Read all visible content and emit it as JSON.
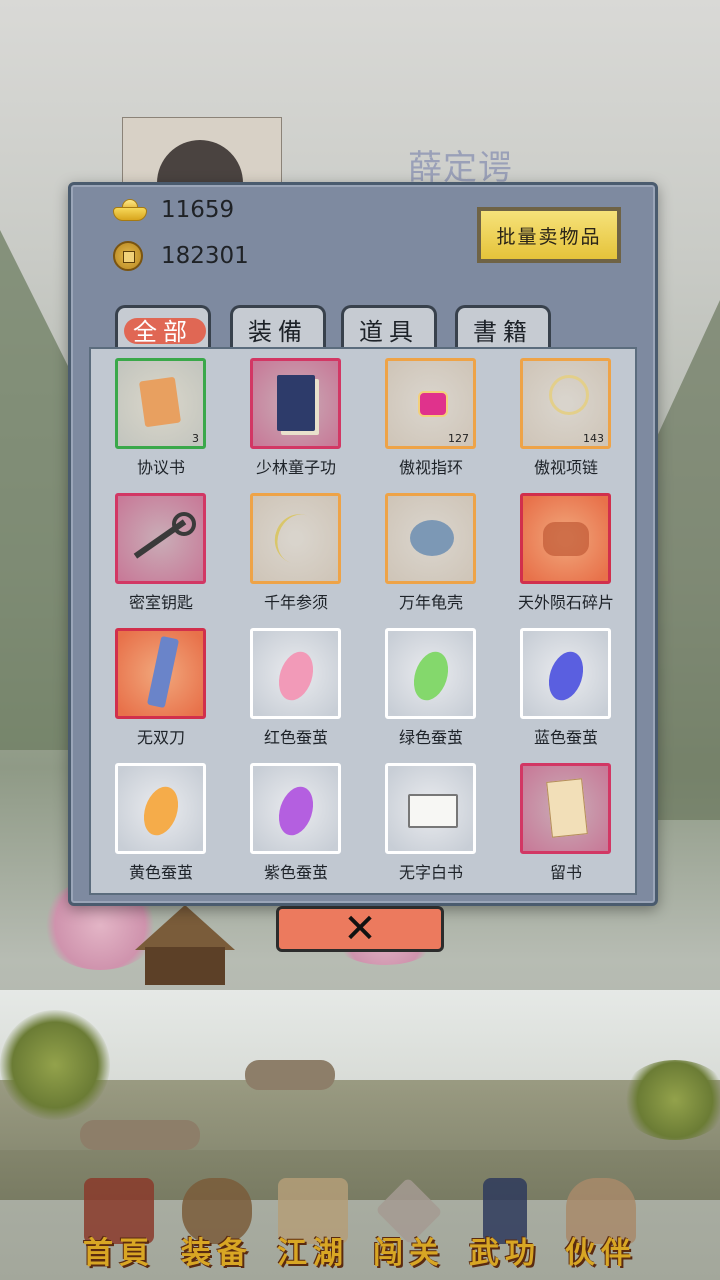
{
  "background": {
    "ghost_name": "薛定谔"
  },
  "currency": {
    "gold": "11659",
    "coins": "182301",
    "gold_icon": "gold-ingot-icon",
    "coin_icon": "copper-coin-icon"
  },
  "panel": {
    "bulk_sell_label": "批量卖物品",
    "tabs": [
      {
        "label": "全部",
        "active": true
      },
      {
        "label": "装備",
        "active": false
      },
      {
        "label": "道具",
        "active": false
      },
      {
        "label": "書籍",
        "active": false
      }
    ],
    "items": [
      {
        "name": "协议书",
        "count": "3",
        "rarity": "green",
        "icon": "document-icon"
      },
      {
        "name": "少林童子功",
        "count": "",
        "rarity": "red",
        "icon": "book-icon"
      },
      {
        "name": "傲视指环",
        "count": "127",
        "rarity": "orange",
        "icon": "ring-icon"
      },
      {
        "name": "傲视项链",
        "count": "143",
        "rarity": "orange",
        "icon": "necklace-icon"
      },
      {
        "name": "密室钥匙",
        "count": "",
        "rarity": "red",
        "icon": "key-icon"
      },
      {
        "name": "千年参须",
        "count": "",
        "rarity": "orange",
        "icon": "ginseng-icon"
      },
      {
        "name": "万年龟壳",
        "count": "",
        "rarity": "orange",
        "icon": "turtle-shell-icon"
      },
      {
        "name": "天外陨石碎片",
        "count": "",
        "rarity": "crimson",
        "icon": "meteorite-icon"
      },
      {
        "name": "无双刀",
        "count": "",
        "rarity": "crimson",
        "icon": "saber-icon"
      },
      {
        "name": "红色蚕茧",
        "count": "",
        "rarity": "white",
        "icon": "red-cocoon-icon"
      },
      {
        "name": "绿色蚕茧",
        "count": "",
        "rarity": "white",
        "icon": "green-cocoon-icon"
      },
      {
        "name": "蓝色蚕茧",
        "count": "",
        "rarity": "white",
        "icon": "blue-cocoon-icon"
      },
      {
        "name": "黄色蚕茧",
        "count": "",
        "rarity": "white",
        "icon": "yellow-cocoon-icon"
      },
      {
        "name": "紫色蚕茧",
        "count": "",
        "rarity": "white",
        "icon": "purple-cocoon-icon"
      },
      {
        "name": "无字白书",
        "count": "",
        "rarity": "white",
        "icon": "open-book-icon"
      },
      {
        "name": "留书",
        "count": "",
        "rarity": "red",
        "icon": "letter-icon"
      }
    ],
    "close_label": "✕"
  },
  "nav": [
    {
      "label": "首頁",
      "icon": "home-icon"
    },
    {
      "label": "装备",
      "icon": "armor-icon"
    },
    {
      "label": "江湖",
      "icon": "map-scroll-icon"
    },
    {
      "label": "闯关",
      "icon": "crossed-swords-icon"
    },
    {
      "label": "武功",
      "icon": "martial-book-icon"
    },
    {
      "label": "伙伴",
      "icon": "companions-icon"
    }
  ],
  "colors": {
    "panel_bg": "#7e8aa0",
    "active_tab": "#e2614d",
    "close_button": "#ec7a5e",
    "bulk_button": "#e5c33a",
    "nav_label": "#d8a624"
  }
}
